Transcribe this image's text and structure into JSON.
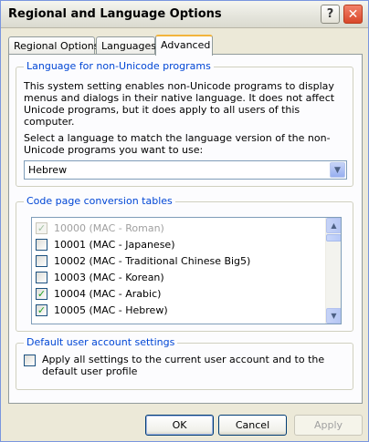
{
  "window": {
    "title": "Regional and Language Options"
  },
  "tabs": [
    {
      "label": "Regional Options"
    },
    {
      "label": "Languages"
    },
    {
      "label": "Advanced"
    }
  ],
  "non_unicode": {
    "legend": "Language for non-Unicode programs",
    "description": "This system setting enables non-Unicode programs to display menus and dialogs in their native language. It does not affect Unicode programs, but it does apply to all users of this computer.",
    "instruction": "Select a language to match the language version of the non-Unicode programs you want to use:",
    "selected": "Hebrew"
  },
  "code_pages": {
    "legend": "Code page conversion tables",
    "items": [
      {
        "label": "10000 (MAC - Roman)",
        "checked": true,
        "disabled": true
      },
      {
        "label": "10001 (MAC - Japanese)",
        "checked": false,
        "disabled": false
      },
      {
        "label": "10002 (MAC - Traditional Chinese Big5)",
        "checked": false,
        "disabled": false
      },
      {
        "label": "10003 (MAC - Korean)",
        "checked": false,
        "disabled": false
      },
      {
        "label": "10004 (MAC - Arabic)",
        "checked": true,
        "disabled": false
      },
      {
        "label": "10005 (MAC - Hebrew)",
        "checked": true,
        "disabled": false
      }
    ]
  },
  "default_user": {
    "legend": "Default user account settings",
    "checkbox_label": "Apply all settings to the current user account and to the default user profile",
    "checked": false
  },
  "buttons": {
    "ok": "OK",
    "cancel": "Cancel",
    "apply": "Apply"
  },
  "icons": {
    "help": "help-icon",
    "close": "close-icon",
    "check": "checkmark-icon",
    "dropdown": "chevron-down-icon"
  },
  "colors": {
    "accent": "#0046d5",
    "check": "#21a121",
    "close": "#d8472a",
    "tab_highlight": "#f2b43d"
  }
}
